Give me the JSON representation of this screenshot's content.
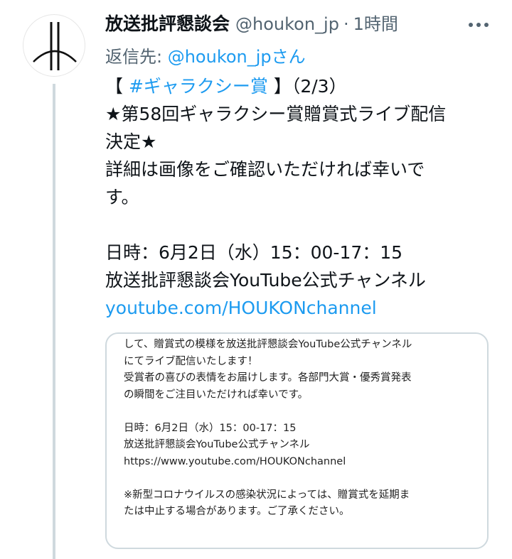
{
  "tweet": {
    "display_name": "放送批評懇談会",
    "handle": "@houkon_jp",
    "separator": "·",
    "timestamp": "1時間",
    "reply_prefix": "返信先: ",
    "reply_to": "@houkon_jp",
    "reply_suffix": "さん",
    "body": {
      "bracket_open": "【 ",
      "hashtag": "#ギャラクシー賞",
      "bracket_close": " 】（2/3）",
      "line2": "★第58回ギャラクシー賞贈賞式ライブ配信",
      "line3": "決定★",
      "line4": "詳細は画像をご確認いただければ幸いで",
      "line5": "す。",
      "line6": "日時：6月2日（水）15：00-17：15",
      "line7": "放送批評懇談会YouTube公式チャンネル",
      "link": "youtube.com/HOUKONchannel"
    },
    "image_card": {
      "lines": [
        "して、贈賞式の模様を放送批評懇談会YouTube公式チャンネル",
        "にてライブ配信いたします！",
        "受賞者の喜びの表情をお届けします。各部門大賞・優秀賞発表",
        "の瞬間をご注目いただければ幸いです。",
        "",
        "日時：6月2日（水）15：00-17：15",
        "放送批評懇談会YouTube公式チャンネル",
        "https://www.youtube.com/HOUKONchannel",
        "",
        "※新型コロナウイルスの感染状況によっては、贈賞式を延期ま",
        "たは中止する場合があります。ご了承ください。"
      ]
    }
  },
  "colors": {
    "accent": "#1d9bf0",
    "secondary_text": "#536471",
    "border": "#cfd9de"
  },
  "icons": {
    "more": "more-horizontal-icon",
    "avatar": "houkon-logo"
  }
}
